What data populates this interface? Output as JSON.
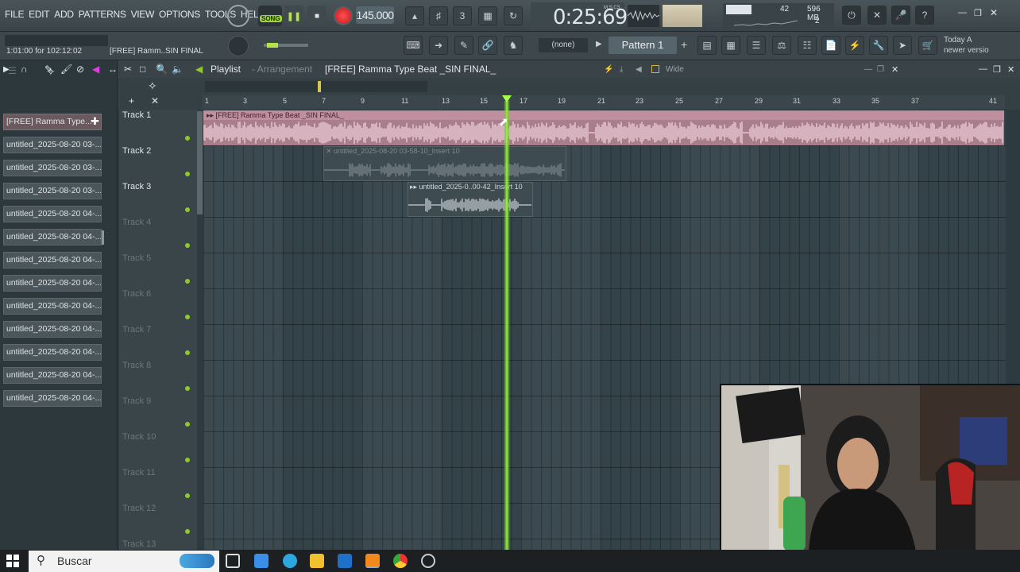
{
  "menu": [
    "FILE",
    "EDIT",
    "ADD",
    "PATTERNS",
    "VIEW",
    "OPTIONS",
    "TOOLS",
    "HELP"
  ],
  "transport": {
    "mode_label": "SONG",
    "tempo": "145.000",
    "time": "0:25:69",
    "time_unit": "M:S:CS"
  },
  "cpu": {
    "value": "42",
    "memory": "596 MB",
    "polyphony": "2"
  },
  "hint_panel": {
    "line1": "Today  A",
    "line2": "newer versio"
  },
  "status": {
    "timecode": "1:01:00 for 102:12:02",
    "hint": "[FREE] Ramm..SIN FINAL"
  },
  "channel_select": "(none)",
  "pattern_select": "Pattern 1",
  "colors": {
    "accent_green": "#8ec82c",
    "record_red": "#e22222",
    "clip_pink": "#bf8fa0"
  },
  "browser": {
    "items": [
      "[FREE] Ramma Type...",
      "untitled_2025-08-20 03-...",
      "untitled_2025-08-20 03-...",
      "untitled_2025-08-20 03-...",
      "untitled_2025-08-20 04-...",
      "untitled_2025-08-20 04-...",
      "untitled_2025-08-20 04-...",
      "untitled_2025-08-20 04-...",
      "untitled_2025-08-20 04-...",
      "untitled_2025-08-20 04-...",
      "untitled_2025-08-20 04-...",
      "untitled_2025-08-20 04-...",
      "untitled_2025-08-20 04-..."
    ]
  },
  "playlist": {
    "title": "Playlist",
    "sep": " - ",
    "subtitle": "Arrangement",
    "project": "[FREE] Ramma Type Beat _SIN FINAL_",
    "snap": "Wide",
    "ruler": [
      "1",
      "3",
      "5",
      "7",
      "9",
      "11",
      "13",
      "15",
      "17",
      "19",
      "21",
      "23",
      "25",
      "27",
      "29",
      "31",
      "33",
      "35",
      "37",
      "41"
    ],
    "tracks": [
      "Track 1",
      "Track 2",
      "Track 3",
      "Track 4",
      "Track 5",
      "Track 6",
      "Track 7",
      "Track 8",
      "Track 9",
      "Track 10",
      "Track 11",
      "Track 12",
      "Track 13"
    ],
    "clips": [
      {
        "name": "[FREE] Ramma Type Beat _SIN FINAL_"
      },
      {
        "name": "untitled_2025-08-20 03-58-10_Insert 10"
      },
      {
        "name": "untitled_2025-0..00-42_Insert 10"
      }
    ]
  },
  "taskbar": {
    "search_placeholder": "Buscar"
  }
}
